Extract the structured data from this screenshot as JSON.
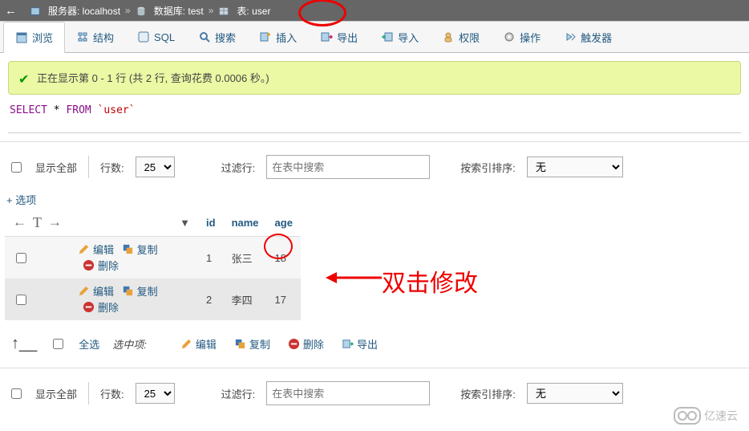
{
  "breadcrumb": {
    "serverLabel": "服务器: localhost",
    "dbLabel": "数据库: test",
    "tableLabel": "表: user"
  },
  "tabs": {
    "browse": "浏览",
    "structure": "结构",
    "sql": "SQL",
    "search": "搜索",
    "insert": "插入",
    "export": "导出",
    "import": "导入",
    "privileges": "权限",
    "operations": "操作",
    "triggers": "触发器"
  },
  "msg": {
    "text": "正在显示第 0 - 1 行 (共 2 行, 查询花费 0.0006 秒。)"
  },
  "sql": {
    "select": "SELECT",
    "star": "*",
    "from": "FROM",
    "table": "`user`"
  },
  "toolbar": {
    "showAll": "显示全部",
    "rows": "行数:",
    "rowsVal": "25",
    "filterLabel": "过滤行:",
    "filterPlaceholder": "在表中搜索",
    "sortLabel": "按索引排序:",
    "sortVal": "无"
  },
  "optionsLink": "+ 选项",
  "gridHead": {
    "id": "id",
    "name": "name",
    "age": "age"
  },
  "actions": {
    "edit": "编辑",
    "copy": "复制",
    "delete": "删除"
  },
  "rows": [
    {
      "id": "1",
      "name": "张三",
      "age": "18"
    },
    {
      "id": "2",
      "name": "李四",
      "age": "17"
    }
  ],
  "bulk": {
    "checkAll": "全选",
    "withSelected": "选中项:",
    "edit": "编辑",
    "copy": "复制",
    "delete": "删除",
    "export": "导出"
  },
  "annot": {
    "text": "双击修改"
  },
  "watermark": "亿速云"
}
